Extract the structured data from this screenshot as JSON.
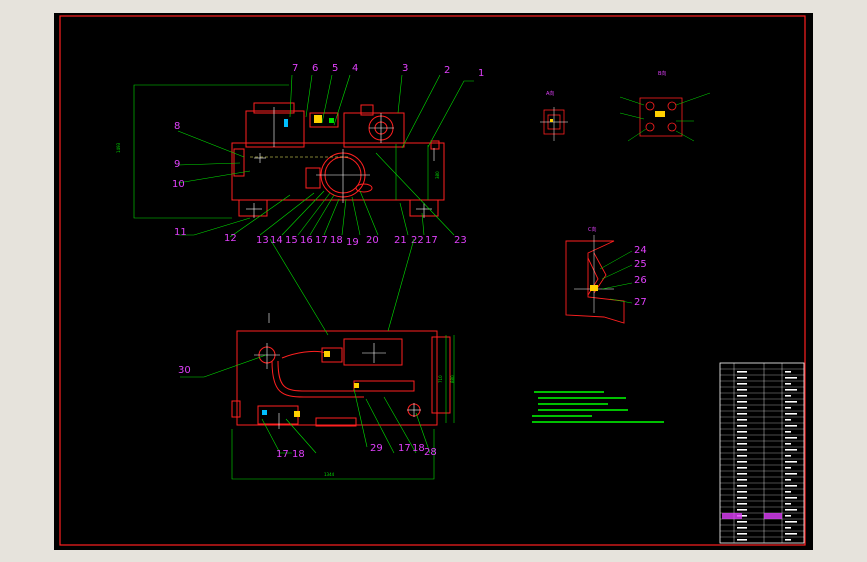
{
  "leaders_top": [
    "7",
    "6",
    "5",
    "4",
    "3",
    "2",
    "1",
    "8",
    "9",
    "10",
    "11",
    "12"
  ],
  "leaders_bottom_row": [
    "13",
    "14",
    "15",
    "16",
    "17",
    "18",
    "19",
    "20",
    "21",
    "22",
    "17",
    "23"
  ],
  "leaders_right_detail": [
    "24",
    "25",
    "26",
    "27"
  ],
  "leaders_plan": [
    "30",
    "17",
    "18",
    "29",
    "17",
    "18",
    "28"
  ],
  "detail_titles": [
    "A向",
    "B向",
    "C向"
  ],
  "colors": {
    "outline": "#ff2020",
    "leader": "#00e000",
    "label": "#e040fb",
    "centerline": "#ffffff",
    "background": "#000000"
  }
}
